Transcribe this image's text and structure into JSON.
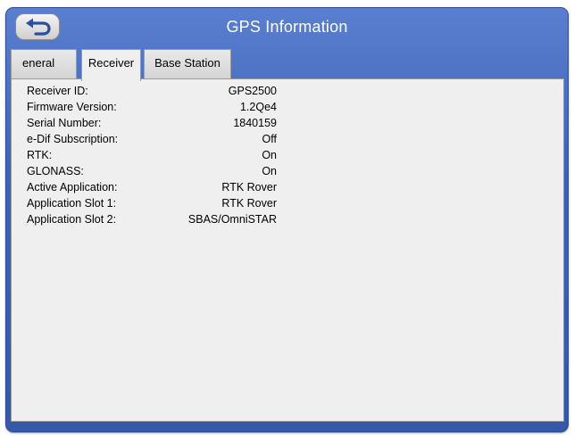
{
  "window": {
    "title": "GPS Information",
    "back_icon": "back-arrow-icon"
  },
  "tabs": [
    {
      "label": "eneral",
      "active": false
    },
    {
      "label": "Receiver",
      "active": true
    },
    {
      "label": "Base Station",
      "active": false
    }
  ],
  "receiver_info": [
    {
      "label": "Receiver ID:",
      "value": "GPS2500"
    },
    {
      "label": "Firmware Version:",
      "value": "1.2Qe4"
    },
    {
      "label": "Serial Number:",
      "value": "1840159"
    },
    {
      "label": "e-Dif Subscription:",
      "value": "Off"
    },
    {
      "label": "RTK:",
      "value": "On"
    },
    {
      "label": "GLONASS:",
      "value": "On"
    },
    {
      "label": "Active Application:",
      "value": "RTK Rover"
    },
    {
      "label": "Application Slot 1:",
      "value": "RTK Rover"
    },
    {
      "label": "Application Slot 2:",
      "value": "SBAS/OmniSTAR"
    }
  ],
  "colors": {
    "titlebar": "#3d62b6",
    "panel": "#efefef",
    "title_text": "#ffffff"
  }
}
